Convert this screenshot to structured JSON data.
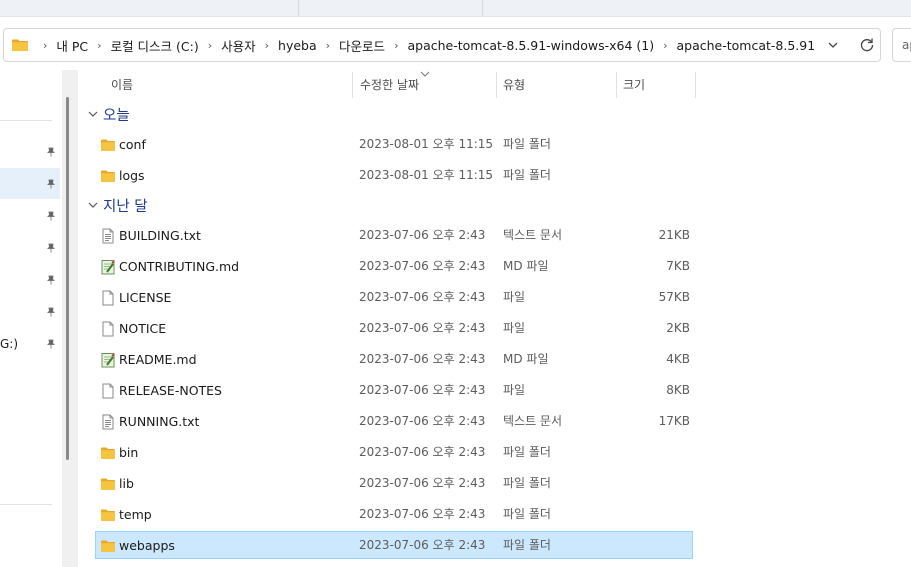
{
  "breadcrumb": {
    "items": [
      "내 PC",
      "로컬 디스크 (C:)",
      "사용자",
      "hyeba",
      "다운로드",
      "apache-tomcat-8.5.91-windows-x64 (1)",
      "apache-tomcat-8.5.91"
    ],
    "separator": "›",
    "folder_icon": "folder-icon",
    "dropdown_icon": "chevron-down-icon",
    "refresh_icon": "refresh-icon"
  },
  "search": {
    "placeholder_fragment": "ap"
  },
  "nav_pane": {
    "drive_label_fragment": "G:)",
    "pin_icon": "pin-icon"
  },
  "columns": {
    "name": "이름",
    "date": "수정한 날짜",
    "type": "유형",
    "size": "크기"
  },
  "groups": [
    {
      "label": "오늘",
      "files": [
        {
          "name": "conf",
          "date": "2023-08-01 오후 11:15",
          "type": "파일 폴더",
          "size": "",
          "icon": "folder-icon",
          "selected": false
        },
        {
          "name": "logs",
          "date": "2023-08-01 오후 11:15",
          "type": "파일 폴더",
          "size": "",
          "icon": "folder-icon",
          "selected": false
        }
      ]
    },
    {
      "label": "지난 달",
      "files": [
        {
          "name": "BUILDING.txt",
          "date": "2023-07-06 오후 2:43",
          "type": "텍스트 문서",
          "size": "21KB",
          "icon": "text-file-icon",
          "selected": false
        },
        {
          "name": "CONTRIBUTING.md",
          "date": "2023-07-06 오후 2:43",
          "type": "MD 파일",
          "size": "7KB",
          "icon": "markdown-file-icon",
          "selected": false
        },
        {
          "name": "LICENSE",
          "date": "2023-07-06 오후 2:43",
          "type": "파일",
          "size": "57KB",
          "icon": "blank-file-icon",
          "selected": false
        },
        {
          "name": "NOTICE",
          "date": "2023-07-06 오후 2:43",
          "type": "파일",
          "size": "2KB",
          "icon": "blank-file-icon",
          "selected": false
        },
        {
          "name": "README.md",
          "date": "2023-07-06 오후 2:43",
          "type": "MD 파일",
          "size": "4KB",
          "icon": "markdown-file-icon",
          "selected": false
        },
        {
          "name": "RELEASE-NOTES",
          "date": "2023-07-06 오후 2:43",
          "type": "파일",
          "size": "8KB",
          "icon": "blank-file-icon",
          "selected": false
        },
        {
          "name": "RUNNING.txt",
          "date": "2023-07-06 오후 2:43",
          "type": "텍스트 문서",
          "size": "17KB",
          "icon": "text-file-icon",
          "selected": false
        },
        {
          "name": "bin",
          "date": "2023-07-06 오후 2:43",
          "type": "파일 폴더",
          "size": "",
          "icon": "folder-icon",
          "selected": false
        },
        {
          "name": "lib",
          "date": "2023-07-06 오후 2:43",
          "type": "파일 폴더",
          "size": "",
          "icon": "folder-icon",
          "selected": false
        },
        {
          "name": "temp",
          "date": "2023-07-06 오후 2:43",
          "type": "파일 폴더",
          "size": "",
          "icon": "folder-icon",
          "selected": false
        },
        {
          "name": "webapps",
          "date": "2023-07-06 오후 2:43",
          "type": "파일 폴더",
          "size": "",
          "icon": "folder-icon",
          "selected": true
        }
      ]
    }
  ],
  "colors": {
    "selection": "#cce8ff",
    "selection_border": "#99d1ff",
    "group_header": "#1e3a8a",
    "folder": "#f5c542"
  }
}
